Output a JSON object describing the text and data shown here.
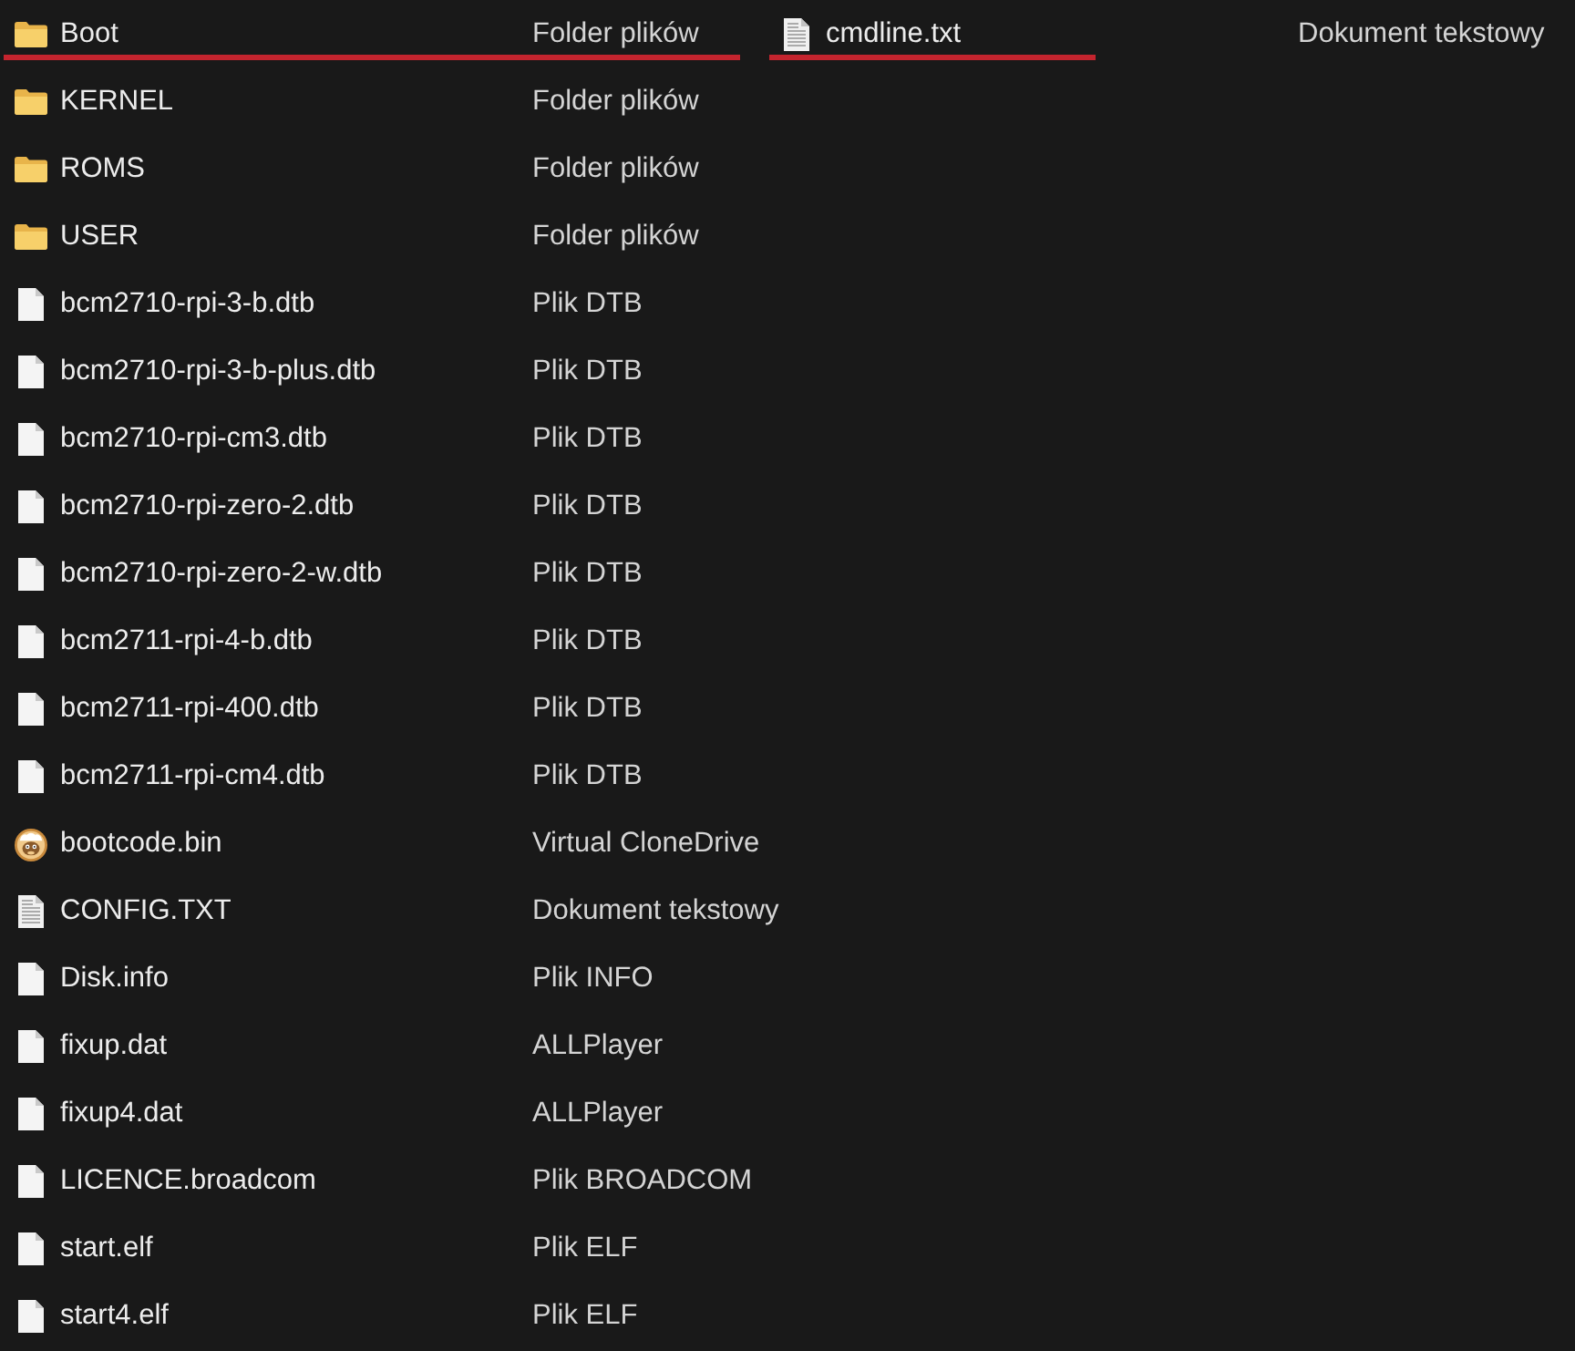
{
  "panes": [
    {
      "files": [
        {
          "name": "Boot",
          "type": "Folder plików",
          "kind": "folder",
          "marked": true
        },
        {
          "name": "KERNEL",
          "type": "Folder plików",
          "kind": "folder",
          "marked": false
        },
        {
          "name": "ROMS",
          "type": "Folder plików",
          "kind": "folder",
          "marked": false
        },
        {
          "name": "USER",
          "type": "Folder plików",
          "kind": "folder",
          "marked": false
        },
        {
          "name": "bcm2710-rpi-3-b.dtb",
          "type": "Plik DTB",
          "kind": "file",
          "marked": false
        },
        {
          "name": "bcm2710-rpi-3-b-plus.dtb",
          "type": "Plik DTB",
          "kind": "file",
          "marked": false
        },
        {
          "name": "bcm2710-rpi-cm3.dtb",
          "type": "Plik DTB",
          "kind": "file",
          "marked": false
        },
        {
          "name": "bcm2710-rpi-zero-2.dtb",
          "type": "Plik DTB",
          "kind": "file",
          "marked": false
        },
        {
          "name": "bcm2710-rpi-zero-2-w.dtb",
          "type": "Plik DTB",
          "kind": "file",
          "marked": false
        },
        {
          "name": "bcm2711-rpi-4-b.dtb",
          "type": "Plik DTB",
          "kind": "file",
          "marked": false
        },
        {
          "name": "bcm2711-rpi-400.dtb",
          "type": "Plik DTB",
          "kind": "file",
          "marked": false
        },
        {
          "name": "bcm2711-rpi-cm4.dtb",
          "type": "Plik DTB",
          "kind": "file",
          "marked": false
        },
        {
          "name": "bootcode.bin",
          "type": "Virtual CloneDrive",
          "kind": "app",
          "marked": false
        },
        {
          "name": "CONFIG.TXT",
          "type": "Dokument tekstowy",
          "kind": "text",
          "marked": false
        },
        {
          "name": "Disk.info",
          "type": "Plik INFO",
          "kind": "file",
          "marked": false
        },
        {
          "name": "fixup.dat",
          "type": "ALLPlayer",
          "kind": "file",
          "marked": false
        },
        {
          "name": "fixup4.dat",
          "type": "ALLPlayer",
          "kind": "file",
          "marked": false
        },
        {
          "name": "LICENCE.broadcom",
          "type": "Plik BROADCOM",
          "kind": "file",
          "marked": false
        },
        {
          "name": "start.elf",
          "type": "Plik ELF",
          "kind": "file",
          "marked": false
        },
        {
          "name": "start4.elf",
          "type": "Plik ELF",
          "kind": "file",
          "marked": false
        }
      ]
    },
    {
      "files": [
        {
          "name": "cmdline.txt",
          "type": "Dokument tekstowy",
          "kind": "text",
          "marked": true
        }
      ]
    }
  ]
}
